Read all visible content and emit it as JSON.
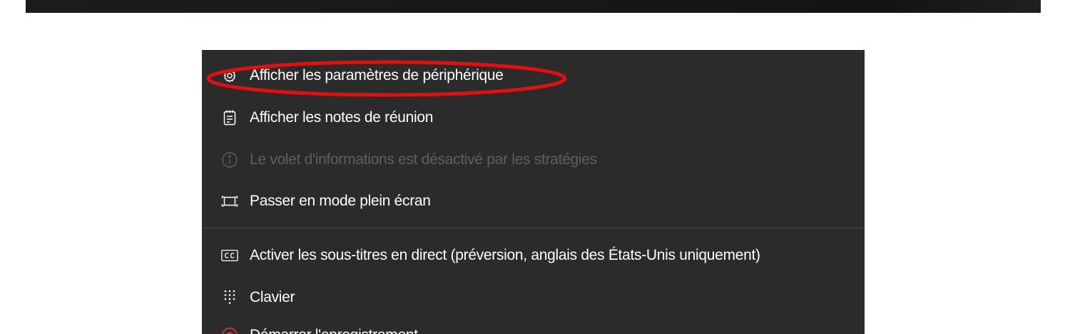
{
  "colors": {
    "menu_bg": "#2b2b2b",
    "text": "#ffffff",
    "disabled_text": "#5f5f5f",
    "annotation": "#e01010",
    "record_icon": "#c4314b"
  },
  "menu": {
    "items": [
      {
        "icon": "gear-icon",
        "label": "Afficher les paramètres de périphérique",
        "enabled": true
      },
      {
        "icon": "notes-icon",
        "label": "Afficher les notes de réunion",
        "enabled": true
      },
      {
        "icon": "info-icon",
        "label": "Le volet d'informations est désactivé par les stratégies",
        "enabled": false
      },
      {
        "icon": "fullscreen-icon",
        "label": "Passer en mode plein écran",
        "enabled": true
      },
      {
        "icon": "closed-captions-icon",
        "label": "Activer les sous-titres en direct (préversion, anglais des États-Unis uniquement)",
        "enabled": true
      },
      {
        "icon": "keypad-icon",
        "label": "Clavier",
        "enabled": true
      },
      {
        "icon": "record-icon",
        "label": "Démarrer l'enregistrement",
        "enabled": true
      }
    ]
  }
}
